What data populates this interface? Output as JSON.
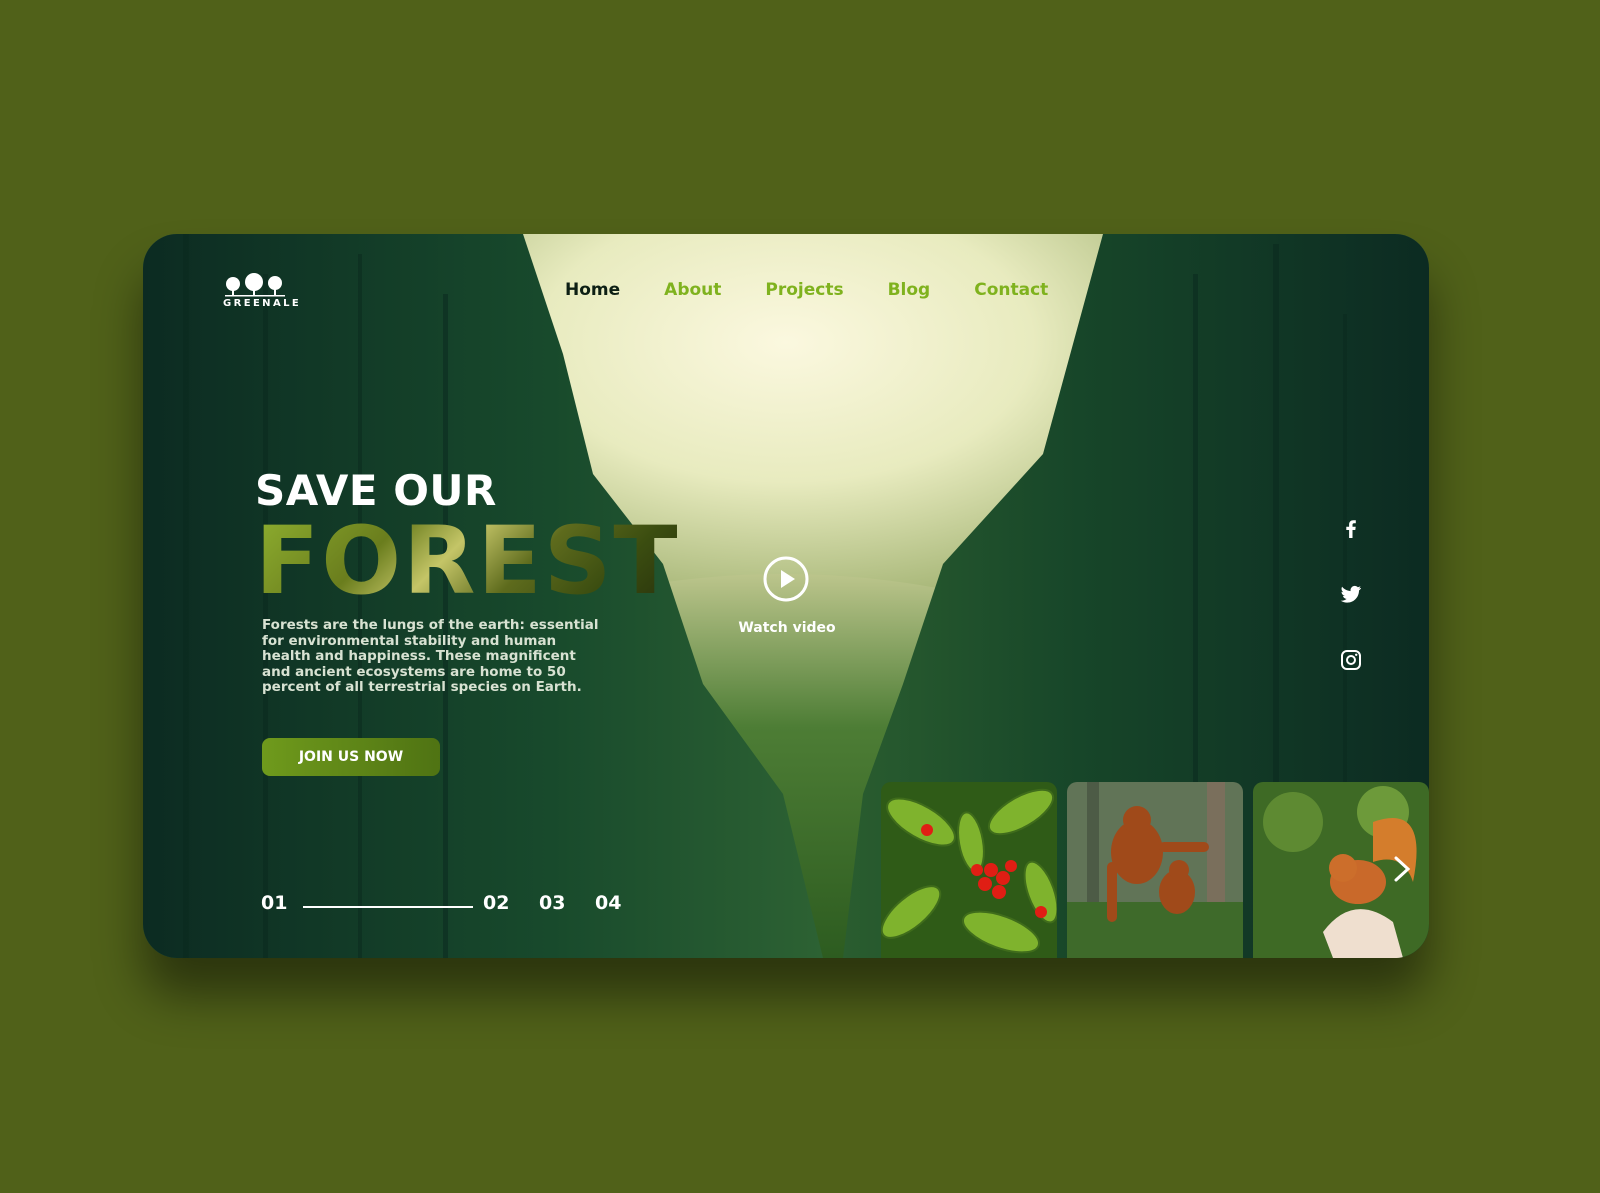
{
  "brand": {
    "name": "GREENALE",
    "logo_icon": "trees-logo-icon"
  },
  "nav": {
    "items": [
      {
        "label": "Home",
        "active": true
      },
      {
        "label": "About",
        "active": false
      },
      {
        "label": "Projects",
        "active": false
      },
      {
        "label": "Blog",
        "active": false
      },
      {
        "label": "Contact",
        "active": false
      }
    ]
  },
  "hero": {
    "title_top": "SAVE OUR",
    "title_main": "FOREST",
    "description": "Forests are the lungs of the earth: essential for environmental stability and human health and happiness. These magnificent and ancient ecosystems are home to 50 percent of all terrestrial species on Earth.",
    "cta_label": "JOIN US NOW"
  },
  "video": {
    "label": "Watch video",
    "icon": "play-icon"
  },
  "social": [
    "facebook-icon",
    "twitter-icon",
    "instagram-icon"
  ],
  "pager": {
    "items": [
      "01",
      "02",
      "03",
      "04"
    ],
    "current": "01"
  },
  "gallery": [
    "berries-plant-image",
    "orangutans-image",
    "squirrel-image"
  ],
  "colors": {
    "page_bg": "#506119",
    "accent": "#7fb21e",
    "nav_active": "#0d1f14",
    "button": "#5e8618"
  }
}
